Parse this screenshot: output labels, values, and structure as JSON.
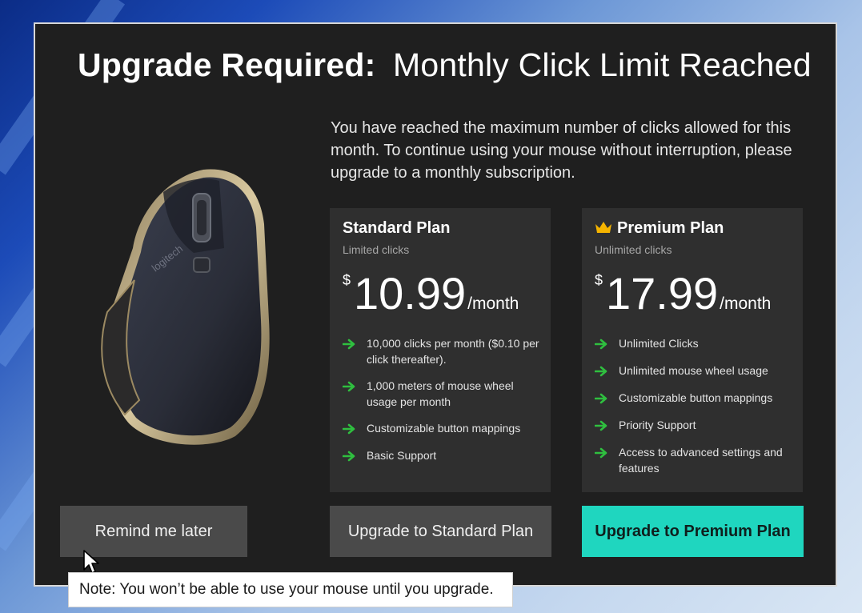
{
  "dialog": {
    "title_strong": "Upgrade Required:",
    "title_light": "Monthly Click Limit Reached",
    "intro": "You have reached the maximum number of clicks allowed for this month.  To continue using your mouse without interruption, please upgrade to a monthly subscription.",
    "product_image": "logitech-mouse"
  },
  "plans": [
    {
      "name": "Standard Plan",
      "subtitle": "Limited clicks",
      "currency": "$",
      "price": "10.99",
      "period": "/month",
      "features": [
        "10,000 clicks per month ($0.10 per click thereafter).",
        "1,000 meters of mouse wheel usage per month",
        "Customizable button mappings",
        "Basic Support"
      ]
    },
    {
      "name": "Premium Plan",
      "subtitle": "Unlimited clicks",
      "currency": "$",
      "price": "17.99",
      "period": "/month",
      "badge_icon": "crown-icon",
      "features": [
        "Unlimited Clicks",
        "Unlimited mouse wheel usage",
        "Customizable button mappings",
        "Priority Support",
        "Access to advanced settings and features"
      ]
    }
  ],
  "buttons": {
    "remind_later": "Remind me later",
    "upgrade_standard": "Upgrade to Standard Plan",
    "upgrade_premium": "Upgrade to Premium Plan"
  },
  "note": "Note:  You won’t be able to use your mouse until you upgrade.",
  "colors": {
    "dialog_bg": "#1f1f1f",
    "card_bg": "#2f2f2f",
    "accent": "#1fd6bf",
    "check_arrow": "#2fbf3f",
    "crown": "#f5b400"
  }
}
